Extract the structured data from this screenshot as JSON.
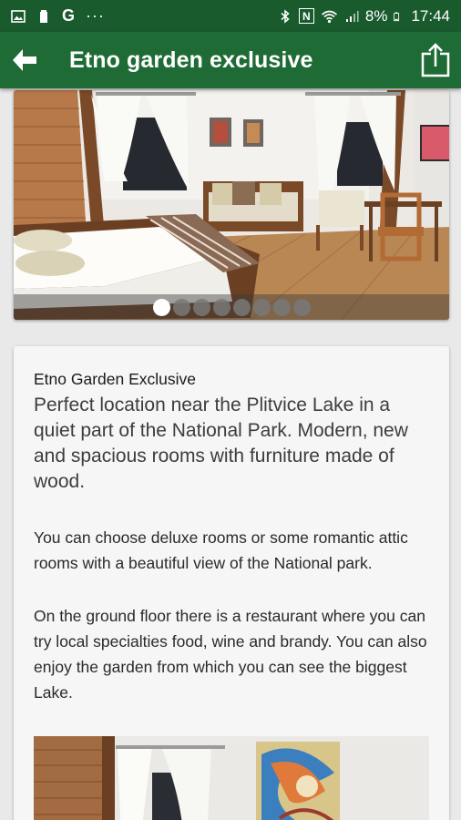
{
  "status_bar": {
    "battery_percent": "8%",
    "time": "17:44",
    "icons_left": [
      "image-icon",
      "battery-saver-icon",
      "google-icon",
      "more-dots-icon"
    ],
    "icons_right": [
      "bluetooth-icon",
      "nfc-icon",
      "wifi-icon",
      "signal-icon",
      "battery-icon"
    ],
    "google_glyph": "G",
    "dots_glyph": "···",
    "nfc_glyph": "N"
  },
  "appbar": {
    "title": "Etno garden exclusive",
    "back_icon": "back-arrow-icon",
    "share_icon": "share-icon"
  },
  "gallery": {
    "slide_count": 8,
    "active_index": 0
  },
  "details": {
    "name": "Etno Garden Exclusive",
    "lead": "Perfect location near the Plitvice Lake in a quiet part of the National Park. Modern, new and spacious rooms with furniture made of wood.",
    "paragraph1": "You can choose deluxe rooms or some romantic attic rooms with a beautiful view of the National park.",
    "paragraph2": "On the ground floor there is a restaurant where you can try local specialties food, wine and brandy. You can also enjoy the garden from which you can see the biggest Lake."
  },
  "colors": {
    "status_bar": "#1a5b2e",
    "app_bar": "#1f6b36",
    "background": "#e9e9e9",
    "card": "#f6f6f6"
  }
}
